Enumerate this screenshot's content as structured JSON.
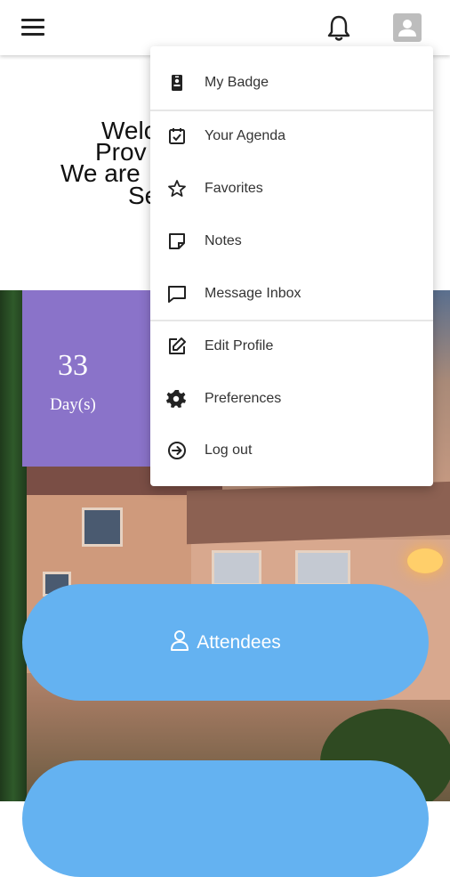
{
  "header": {
    "menu_icon": "hamburger-menu-icon",
    "notification_icon": "bell-icon",
    "profile_icon": "account-avatar-icon"
  },
  "welcome": {
    "line1": "Welc",
    "line2": "Prov",
    "line3": "We are",
    "line4": "Se"
  },
  "countdown": {
    "value": "33",
    "unit": "Day(s)",
    "bg_color": "#8a73c9"
  },
  "buttons": {
    "attendees_label": "Attendees",
    "attendees_icon": "person-icon",
    "color": "#64b2f1"
  },
  "dropdown": {
    "items": [
      {
        "label": "My Badge",
        "icon": "badge-icon"
      },
      {
        "label": "Your Agenda",
        "icon": "calendar-check-icon"
      },
      {
        "label": "Favorites",
        "icon": "star-icon"
      },
      {
        "label": "Notes",
        "icon": "note-icon"
      },
      {
        "label": "Message Inbox",
        "icon": "message-icon"
      },
      {
        "label": "Edit Profile",
        "icon": "edit-icon"
      },
      {
        "label": "Preferences",
        "icon": "gear-icon"
      },
      {
        "label": "Log out",
        "icon": "logout-icon"
      }
    ]
  }
}
